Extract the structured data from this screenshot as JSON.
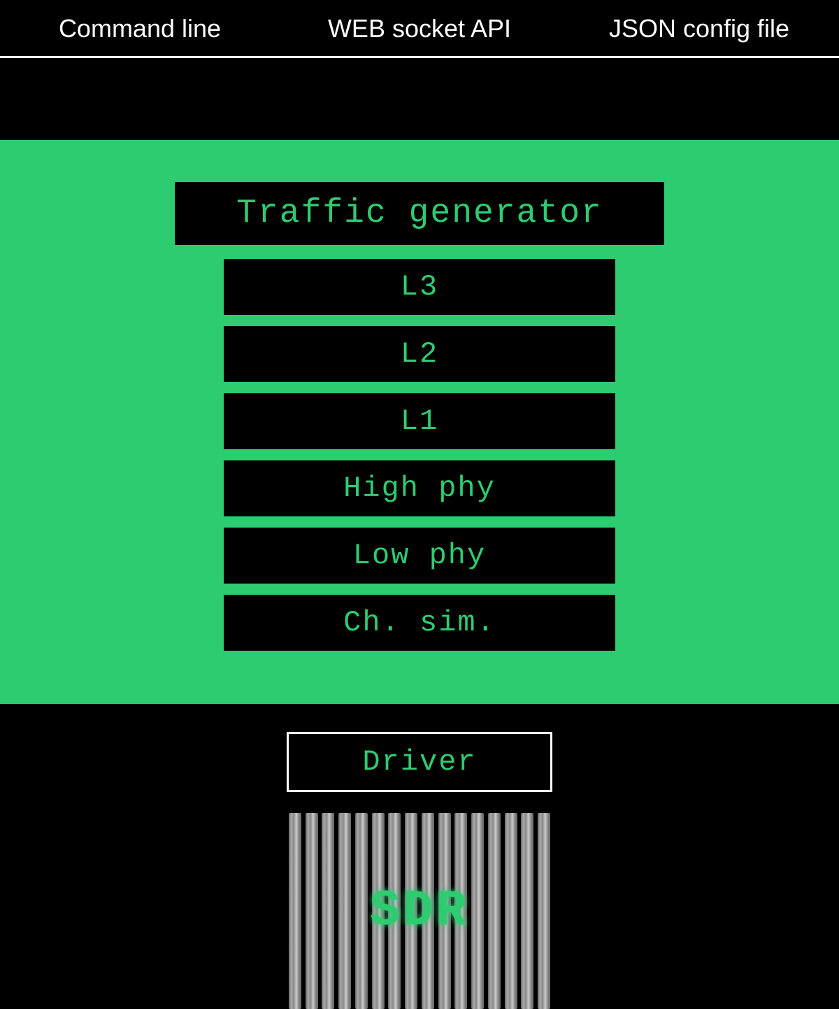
{
  "header": {
    "items": [
      {
        "id": "command-line",
        "label": "Command line"
      },
      {
        "id": "web-socket-api",
        "label": "WEB socket API"
      },
      {
        "id": "json-config-file",
        "label": "JSON config file"
      }
    ]
  },
  "main": {
    "bg_color": "#2ecc71",
    "traffic_generator": {
      "label": "Traffic generator"
    },
    "layers": [
      {
        "id": "l3",
        "label": "L3"
      },
      {
        "id": "l2",
        "label": "L2"
      },
      {
        "id": "l1",
        "label": "L1"
      },
      {
        "id": "high-phy",
        "label": "High phy"
      },
      {
        "id": "low-phy",
        "label": "Low phy"
      },
      {
        "id": "ch-sim",
        "label": "Ch. sim."
      }
    ]
  },
  "bottom": {
    "driver": {
      "label": "Driver"
    },
    "sdr": {
      "label": "SDR"
    }
  }
}
